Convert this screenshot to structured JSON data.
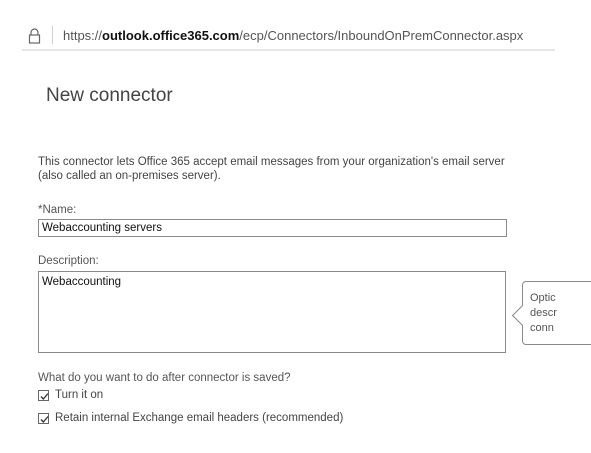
{
  "browser": {
    "url_prefix": "https://",
    "url_domain": "outlook.office365.com",
    "url_path": "/ecp/Connectors/InboundOnPremConnector.aspx"
  },
  "page": {
    "title": "New connector",
    "intro": "This connector lets Office 365 accept email messages from your organization's email server (also called an on-premises server)."
  },
  "form": {
    "name_label": "*Name:",
    "name_value": "Webaccounting servers",
    "description_label": "Description:",
    "description_value": "Webaccounting",
    "callout_text": "Optic\ndescr\nconn",
    "after_save_label": "What do you want to do after connector is saved?",
    "turn_on_label": "Turn it on",
    "turn_on_checked": true,
    "retain_headers_label": "Retain internal Exchange email headers (recommended)",
    "retain_headers_checked": true
  },
  "icons": {
    "lock": "lock-icon",
    "checkmark": "checkmark-icon"
  }
}
